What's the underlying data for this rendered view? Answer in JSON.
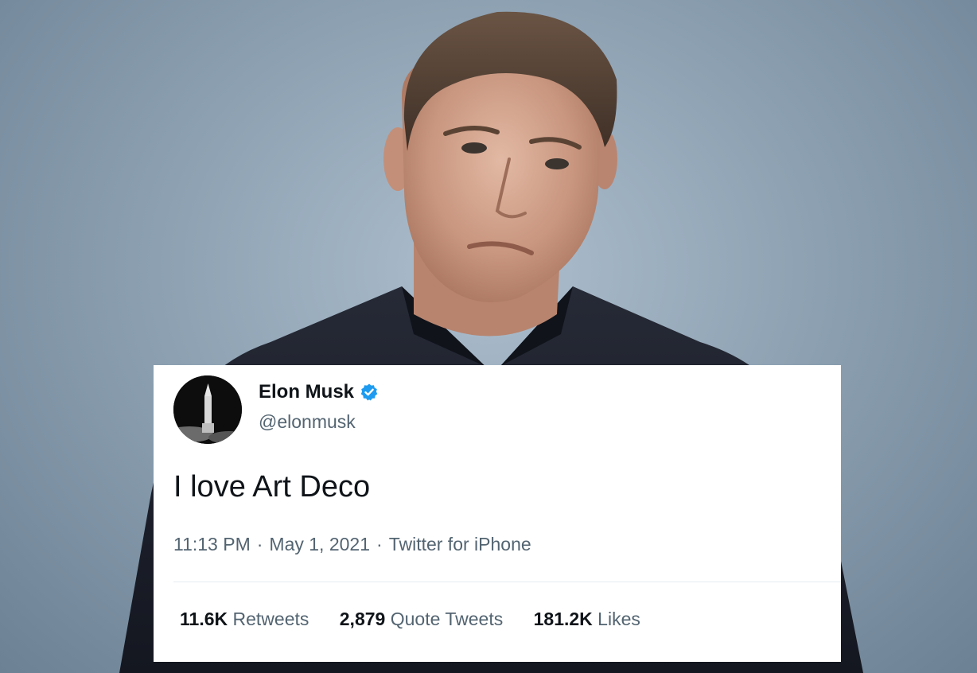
{
  "tweet": {
    "display_name": "Elon Musk",
    "handle": "@elonmusk",
    "text": "I love Art Deco",
    "time": "11:13 PM",
    "date": "May 1, 2021",
    "source": "Twitter for iPhone",
    "separator": "·",
    "stats": [
      {
        "value": "11.6K",
        "label": "Retweets"
      },
      {
        "value": "2,879",
        "label": "Quote Tweets"
      },
      {
        "value": "181.2K",
        "label": "Likes"
      }
    ]
  },
  "icons": {
    "verified": "verified-badge-icon",
    "avatar": "rocket-avatar"
  },
  "colors": {
    "verified_blue": "#1d9bf0",
    "card_background": "#ffffff",
    "text_primary": "#0f1419",
    "text_secondary": "#536471"
  }
}
